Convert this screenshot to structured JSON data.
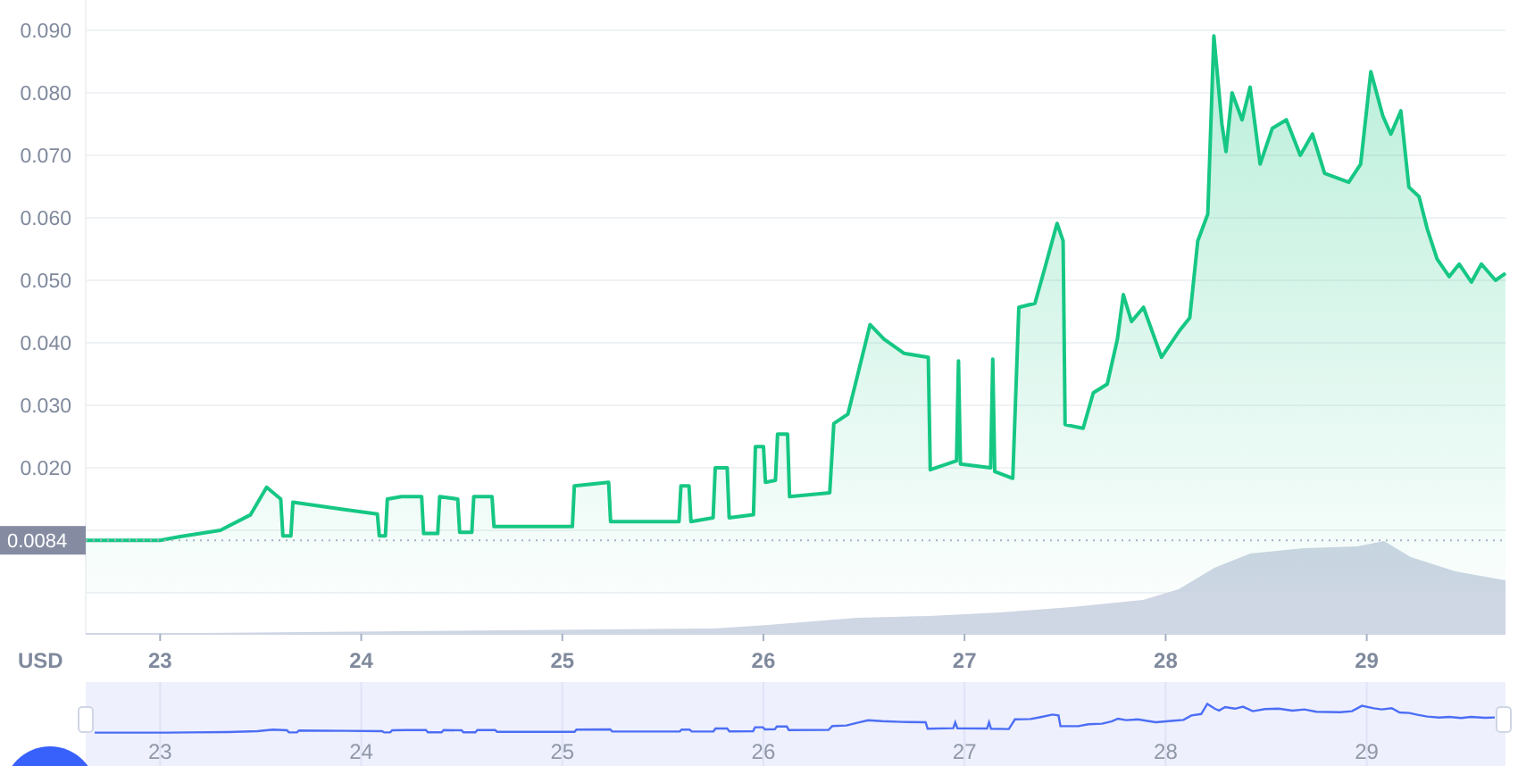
{
  "chart": {
    "chart_data": {
      "type": "area",
      "ylabel": "USD",
      "x": [
        22.63,
        23.0,
        23.1,
        23.3,
        23.45,
        23.53,
        23.6,
        23.61,
        23.65,
        23.66,
        23.9,
        24.08,
        24.09,
        24.12,
        24.13,
        24.2,
        24.3,
        24.31,
        24.38,
        24.39,
        24.48,
        24.49,
        24.55,
        24.56,
        24.65,
        24.66,
        25.05,
        25.06,
        25.23,
        25.24,
        25.58,
        25.59,
        25.63,
        25.64,
        25.75,
        25.76,
        25.82,
        25.83,
        25.95,
        25.96,
        26.0,
        26.01,
        26.06,
        26.07,
        26.12,
        26.13,
        26.33,
        26.35,
        26.42,
        26.48,
        26.53,
        26.6,
        26.7,
        26.82,
        26.83,
        26.96,
        26.97,
        26.98,
        27.13,
        27.14,
        27.15,
        27.24,
        27.27,
        27.35,
        27.4,
        27.46,
        27.49,
        27.5,
        27.59,
        27.64,
        27.71,
        27.76,
        27.79,
        27.83,
        27.89,
        27.98,
        28.07,
        28.12,
        28.16,
        28.21,
        28.24,
        28.28,
        28.3,
        28.33,
        28.38,
        28.42,
        28.47,
        28.53,
        28.6,
        28.67,
        28.73,
        28.79,
        28.91,
        28.97,
        29.02,
        29.08,
        29.12,
        29.17,
        29.21,
        29.26,
        29.3,
        29.35,
        29.41,
        29.46,
        29.52,
        29.57,
        29.64,
        29.69
      ],
      "series": [
        {
          "color": "#16c784",
          "values": [
            0.0084,
            0.0084,
            0.009,
            0.01,
            0.0125,
            0.0169,
            0.015,
            0.0091,
            0.0091,
            0.0145,
            0.0134,
            0.0126,
            0.0091,
            0.0091,
            0.015,
            0.0154,
            0.0154,
            0.0095,
            0.0095,
            0.0154,
            0.015,
            0.0097,
            0.0097,
            0.0154,
            0.0154,
            0.0106,
            0.0106,
            0.0171,
            0.0177,
            0.0114,
            0.0114,
            0.0171,
            0.0171,
            0.0114,
            0.012,
            0.02,
            0.02,
            0.012,
            0.0125,
            0.0234,
            0.0234,
            0.0177,
            0.018,
            0.0254,
            0.0254,
            0.0154,
            0.016,
            0.0271,
            0.0286,
            0.0363,
            0.0429,
            0.0406,
            0.0383,
            0.0377,
            0.0197,
            0.0211,
            0.0371,
            0.0206,
            0.02,
            0.0374,
            0.0194,
            0.0183,
            0.0457,
            0.0463,
            0.052,
            0.0591,
            0.0563,
            0.0269,
            0.0263,
            0.032,
            0.0334,
            0.0406,
            0.0477,
            0.0434,
            0.0457,
            0.0377,
            0.042,
            0.044,
            0.0563,
            0.0606,
            0.0891,
            0.075,
            0.0706,
            0.08,
            0.0757,
            0.0809,
            0.0686,
            0.0743,
            0.0757,
            0.07,
            0.0734,
            0.0671,
            0.0657,
            0.0686,
            0.0834,
            0.0763,
            0.0734,
            0.0771,
            0.0649,
            0.0634,
            0.0583,
            0.0534,
            0.0506,
            0.0526,
            0.0497,
            0.0526,
            0.05,
            0.0511
          ]
        }
      ],
      "xlim": [
        22.63,
        29.69
      ],
      "ylim": [
        0,
        0.09
      ],
      "xticks": [
        {
          "value": 23,
          "label": "23"
        },
        {
          "value": 24,
          "label": "24"
        },
        {
          "value": 25,
          "label": "25"
        },
        {
          "value": 26,
          "label": "26"
        },
        {
          "value": 27,
          "label": "27"
        },
        {
          "value": 28,
          "label": "28"
        },
        {
          "value": 29,
          "label": "29"
        }
      ],
      "grid": true,
      "yticks": [
        {
          "value": 0.02,
          "label": "0.020"
        },
        {
          "value": 0.03,
          "label": "0.030"
        },
        {
          "value": 0.04,
          "label": "0.040"
        },
        {
          "value": 0.05,
          "label": "0.050"
        },
        {
          "value": 0.06,
          "label": "0.060"
        },
        {
          "value": 0.07,
          "label": "0.070"
        },
        {
          "value": 0.08,
          "label": "0.080"
        },
        {
          "value": 0.09,
          "label": "0.090"
        }
      ],
      "ref_lines": [
        {
          "axis": "y",
          "value": 0.0084,
          "label": "0.0084"
        }
      ]
    }
  },
  "navigator": {
    "labels": [
      "23",
      "24",
      "25",
      "26",
      "27",
      "28",
      "29"
    ]
  }
}
